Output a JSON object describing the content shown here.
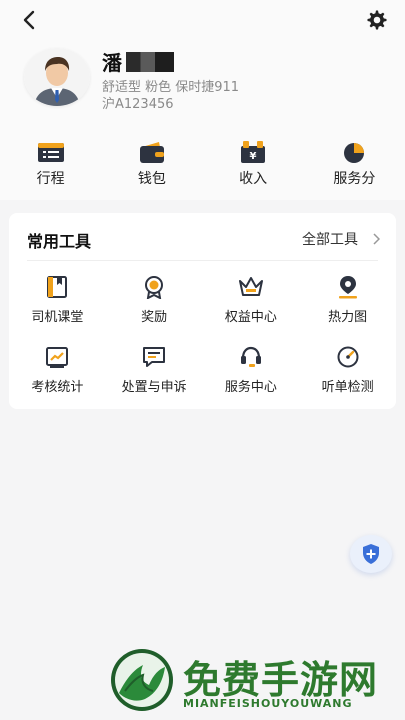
{
  "profile": {
    "name": "潘",
    "car_info": "舒适型 粉色 保时捷911",
    "plate": "沪A123456"
  },
  "quick_actions": [
    {
      "label": "行程",
      "icon": "itinerary-icon"
    },
    {
      "label": "钱包",
      "icon": "wallet-icon"
    },
    {
      "label": "收入",
      "icon": "income-icon"
    },
    {
      "label": "服务分",
      "icon": "service-score-icon"
    }
  ],
  "tools": {
    "title": "常用工具",
    "all_label": "全部工具",
    "items": [
      {
        "label": "司机课堂",
        "icon": "book-icon"
      },
      {
        "label": "奖励",
        "icon": "medal-icon"
      },
      {
        "label": "权益中心",
        "icon": "crown-icon"
      },
      {
        "label": "热力图",
        "icon": "location-pin-icon"
      },
      {
        "label": "考核统计",
        "icon": "chart-icon"
      },
      {
        "label": "处置与申诉",
        "icon": "message-icon"
      },
      {
        "label": "服务中心",
        "icon": "headset-icon"
      },
      {
        "label": "听单检测",
        "icon": "gauge-icon"
      }
    ]
  },
  "watermark": {
    "title": "免费手游网",
    "subtitle": "MIANFEISHOUYOUWANG"
  },
  "colors": {
    "accent": "#f0a21c",
    "dark": "#2d3340",
    "fab": "#3a6fd8"
  }
}
